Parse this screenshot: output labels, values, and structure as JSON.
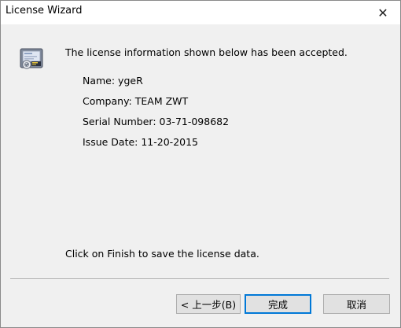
{
  "window": {
    "title": "License Wizard",
    "close_glyph": "✕"
  },
  "icon": {
    "name": "license-certificate-icon"
  },
  "message": {
    "accepted": "The license information shown below has been accepted.",
    "finish_note": "Click on Finish to save the license data."
  },
  "license": {
    "name": "Name: ygeR",
    "company": "Company: TEAM ZWT",
    "serial": "Serial Number: 03-71-098682",
    "issue_date": "Issue Date: 11-20-2015"
  },
  "buttons": {
    "back": "< 上一步(B)",
    "finish": "完成",
    "cancel": "取消"
  }
}
